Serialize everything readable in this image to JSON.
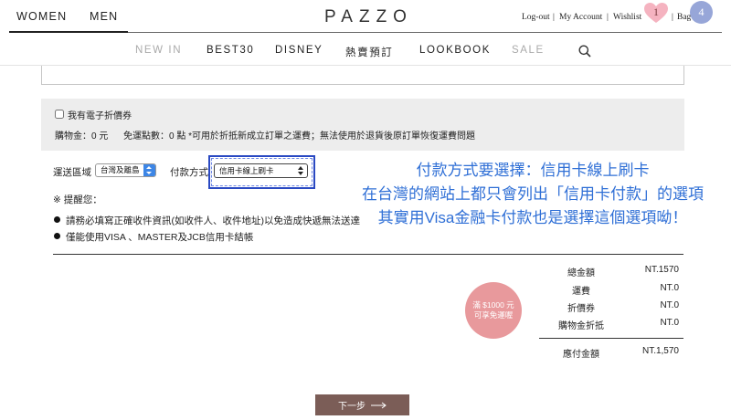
{
  "header": {
    "tabs": [
      {
        "label": "WOMEN",
        "active": true
      },
      {
        "label": "MEN",
        "active": false
      }
    ],
    "logo": "PAZZO",
    "account": {
      "logout": "Log-out",
      "my_account": "My Account",
      "wishlist": "Wishlist",
      "wishlist_count": "1",
      "bag": "Bag",
      "bag_count": "4",
      "separator": "|"
    }
  },
  "nav": {
    "items": [
      {
        "label": "NEW IN",
        "muted": true
      },
      {
        "label": "BEST30",
        "muted": false
      },
      {
        "label": "DISNEY",
        "muted": false
      },
      {
        "label": "熱賣預訂",
        "muted": false
      },
      {
        "label": "LOOKBOOK",
        "muted": false
      },
      {
        "label": "SALE",
        "muted": true
      }
    ]
  },
  "coupon": {
    "checkbox_label": "我有電子折價券",
    "checked": false,
    "balance": "購物金：0 元",
    "shipping_points": "免運點數：0 點 *可用於折抵新成立訂單之運費；無法使用於退貨後原訂單恢復運費問題"
  },
  "shipping": {
    "region_label": "運送區域",
    "region_value": "台灣及離島",
    "payment_label": "付款方式",
    "payment_value": "信用卡線上刷卡"
  },
  "annotation": {
    "lines": [
      "付款方式要選擇：信用卡線上刷卡",
      "在台灣的網站上都只會列出「信用卡付款」的選項",
      "其實用Visa金融卡付款也是選擇這個選項呦！"
    ]
  },
  "notice": {
    "title": "※ 提醒您：",
    "bullets": [
      "請務必填寫正確收件資訊(如收件人、收件地址)以免造成快遞無法送達",
      "僅能使用VISA 、MASTER及JCB信用卡結帳"
    ]
  },
  "promo": {
    "line1": "滿 $1000 元",
    "line2": "可享免運喔"
  },
  "summary": {
    "rows": [
      {
        "label": "總金額",
        "value": "NT.1570"
      },
      {
        "label": "運費",
        "value": "NT.0"
      },
      {
        "label": "折價券",
        "value": "NT.0"
      },
      {
        "label": "購物金折抵",
        "value": "NT.0"
      }
    ],
    "total": {
      "label": "應付金額",
      "value": "NT.1,570"
    }
  },
  "next_button": {
    "label": "下一步"
  },
  "icons": [
    "heart-icon",
    "search-icon",
    "select-arrows-icon",
    "arrow-right-icon",
    "bullet-icon"
  ],
  "colors": {
    "wishlist_badge": "#f5b3c0",
    "bag_badge": "#97a6d8",
    "annotation_text": "#2f6fd6",
    "highlight_border": "#2a49c2",
    "select_arrow": "#3d86e6",
    "promo_circle": "#e8999c",
    "next_button": "#7b5d57",
    "panel_bg": "#ededed"
  }
}
